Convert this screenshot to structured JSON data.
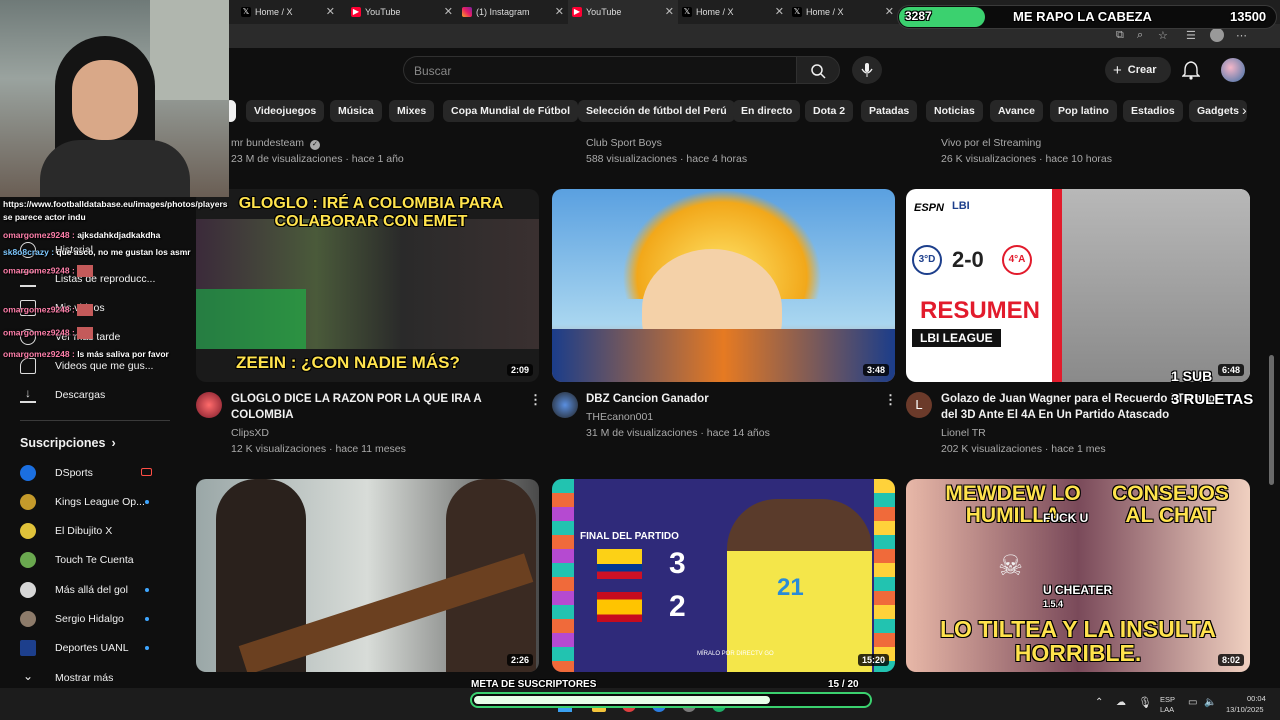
{
  "browser": {
    "tabs": [
      {
        "label": "Home / X",
        "icon": "x-logo-icon"
      },
      {
        "label": "YouTube",
        "icon": "youtube-icon"
      },
      {
        "label": "(1) Instagram",
        "icon": "instagram-icon"
      },
      {
        "label": "YouTube",
        "icon": "youtube-icon"
      },
      {
        "label": "Home / X",
        "icon": "x-logo-icon"
      },
      {
        "label": "Home / X",
        "icon": "x-logo-icon"
      }
    ]
  },
  "overlay_goal": {
    "current": "3287",
    "text": "ME RAPO LA CABEZA",
    "target": "13500",
    "progress": 0.24
  },
  "header": {
    "search_placeholder": "Buscar",
    "create_label": "Crear"
  },
  "chips": [
    "Videojuegos",
    "Música",
    "Mixes",
    "Copa Mundial de Fútbol",
    "Selección de fútbol del Perú",
    "En directo",
    "Dota 2",
    "Patadas",
    "Noticias",
    "Avance",
    "Pop latino",
    "Estadios",
    "Gadgets"
  ],
  "sidebar": {
    "you_items": [
      {
        "label": "Historial",
        "icon": "history-icon"
      },
      {
        "label": "Listas de reproducc...",
        "icon": "playlist-icon"
      },
      {
        "label": "Mis videos",
        "icon": "my-videos-icon"
      },
      {
        "label": "Ver más tarde",
        "icon": "watch-later-icon"
      },
      {
        "label": "Videos que me gus...",
        "icon": "like-icon"
      },
      {
        "label": "Descargas",
        "icon": "download-icon"
      }
    ],
    "subscriptions_title": "Suscripciones",
    "subscriptions": [
      {
        "label": "DSports",
        "live": true,
        "color": "#1b6fe0"
      },
      {
        "label": "Kings League Op...",
        "live": false,
        "dot": true,
        "color": "#c49a2b"
      },
      {
        "label": "El Dibujito X",
        "live": false,
        "dot": false,
        "color": "#e0c23a"
      },
      {
        "label": "Touch Te Cuenta",
        "live": false,
        "dot": false,
        "color": "#6aa84f"
      },
      {
        "label": "Más allá del gol",
        "live": false,
        "dot": true,
        "color": "#d7d7d7"
      },
      {
        "label": "Sergio Hidalgo",
        "live": false,
        "dot": true,
        "color": "#8d7b6a"
      },
      {
        "label": "Deportes UANL",
        "live": false,
        "dot": true,
        "color": "#1d3f8c"
      }
    ],
    "show_more": "Mostrar más"
  },
  "top_row": [
    {
      "channel": "mr bundesteam",
      "verified": true,
      "meta": "23 M de visualizaciones · hace 1 año"
    },
    {
      "channel": "Club Sport Boys",
      "verified": false,
      "meta": "588 visualizaciones · hace 4 horas"
    },
    {
      "channel": "Vivo por el Streaming",
      "verified": false,
      "meta": "26 K visualizaciones · hace 10 horas"
    }
  ],
  "videos": [
    {
      "title": "GLOGLO DICE LA RAZON POR LA QUE IRA A COLOMBIA",
      "channel": "ClipsXD",
      "meta": "12 K visualizaciones · hace 11 meses",
      "duration": "2:09",
      "thumb_top": "GLOGLO : IRÉ A COLOMBIA PARA COLABORAR CON EMET",
      "thumb_bottom": "ZEEIN : ¿CON NADIE MÁS?"
    },
    {
      "title": "DBZ Cancion Ganador",
      "channel": "THEcanon001",
      "meta": "31 M de visualizaciones · hace 14 años",
      "duration": "3:48"
    },
    {
      "title": "Golazo de Juan Wagner para el Recuerdo | Torneo del 3D Ante El 4A En Un Partido Atascado",
      "channel": "Lionel TR",
      "meta": "202 K visualizaciones · hace 1 mes",
      "duration": "6:48",
      "thumb_score": "2-0",
      "thumb_left": "3°D",
      "thumb_right": "4°A",
      "thumb_banner": "RESUMEN",
      "thumb_sub": "LBI LEAGUE",
      "thumb_brand1": "ESPN",
      "thumb_brand2": "LBI"
    },
    {
      "duration": "2:26"
    },
    {
      "duration": "15:20",
      "thumb_label": "FINAL DEL PARTIDO",
      "score_a": "3",
      "score_b": "2",
      "jersey": "21",
      "thumb_footer": "MÍRALO POR DIRECTV GO"
    },
    {
      "duration": "8:02",
      "thumb_top_left": "MEWDEW LO HUMILLA",
      "thumb_top_right": "CONSEJOS AL CHAT",
      "thumb_mid1": "FUCK U",
      "thumb_mid2": "U CHEATER",
      "thumb_mid3": "1.5.4",
      "thumb_bottom": "LO TILTEA Y LA INSULTA HORRIBLE."
    }
  ],
  "chat": {
    "lines": [
      {
        "user": "",
        "text": "https://www.footballdatabase.eu/images/photos/players"
      },
      {
        "user": "",
        "text": "se parece actor indu"
      },
      {
        "user": "omargomez9248 :",
        "text": "ajksdahkdjadkakdha"
      },
      {
        "user": "sk8o8crazy :",
        "text": "que asco, no me gustan los asmr"
      },
      {
        "user": "omargomez9248 :",
        "text": ""
      },
      {
        "user": "omargomez9248 :",
        "text": ""
      },
      {
        "user": "omargomez9248 :",
        "text": ""
      },
      {
        "user": "omargomez9248 :",
        "text": "ls más saliva por favor"
      }
    ]
  },
  "overlay_side": {
    "subs_line1": "1 SUB",
    "subs_line2": "3 RULETAS"
  },
  "subgoal": {
    "label": "META DE SUSCRIPTORES",
    "count": "15 / 20",
    "progress": 0.75
  },
  "taskbar": {
    "lang1": "ESP",
    "lang2": "LAA",
    "time": "00:04",
    "date": "13/10/2025"
  },
  "colors": {
    "bg": "#0f0f0f",
    "goal_green": "#3bd16f",
    "live_red": "#ff4e45"
  }
}
